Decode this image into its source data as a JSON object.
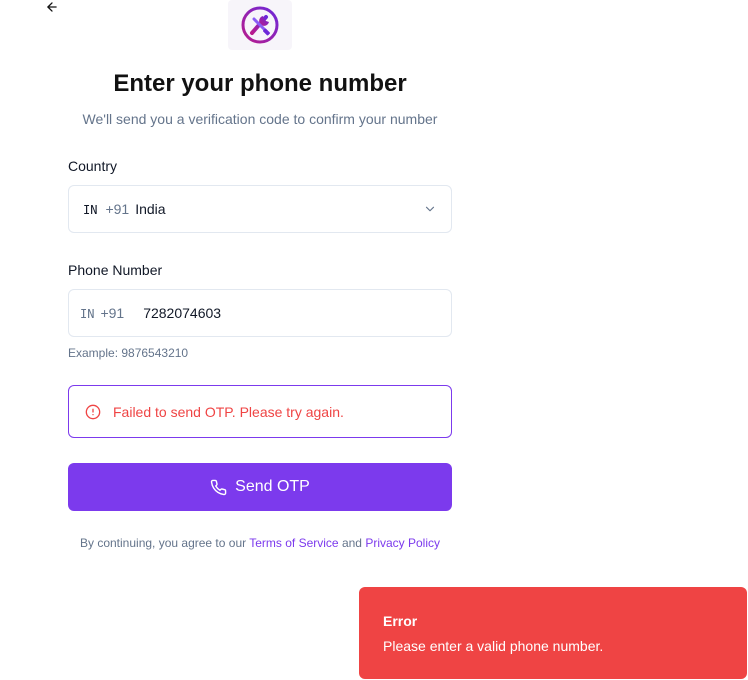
{
  "header": {
    "back_icon": "arrow-left-icon",
    "logo_icon": "wrench-screwdriver-logo"
  },
  "main": {
    "title": "Enter your phone number",
    "subtitle": "We'll send you a verification code to confirm your number"
  },
  "country": {
    "label": "Country",
    "iso": "IN",
    "dial_code": "+91",
    "selected": "India"
  },
  "phone": {
    "label": "Phone Number",
    "iso": "IN",
    "dial_code": "+91",
    "value": "7282074603",
    "example": "Example: 9876543210"
  },
  "alert": {
    "message": "Failed to send OTP. Please try again."
  },
  "actions": {
    "send_label": "Send OTP"
  },
  "terms": {
    "prefix": "By continuing, you agree to our",
    "tos": "Terms of Service",
    "and": "and",
    "privacy": "Privacy Policy"
  },
  "toast": {
    "title": "Error",
    "message": "Please enter a valid phone number."
  },
  "colors": {
    "accent": "#7c3aed",
    "error": "#ef4444",
    "muted": "#64748b"
  }
}
